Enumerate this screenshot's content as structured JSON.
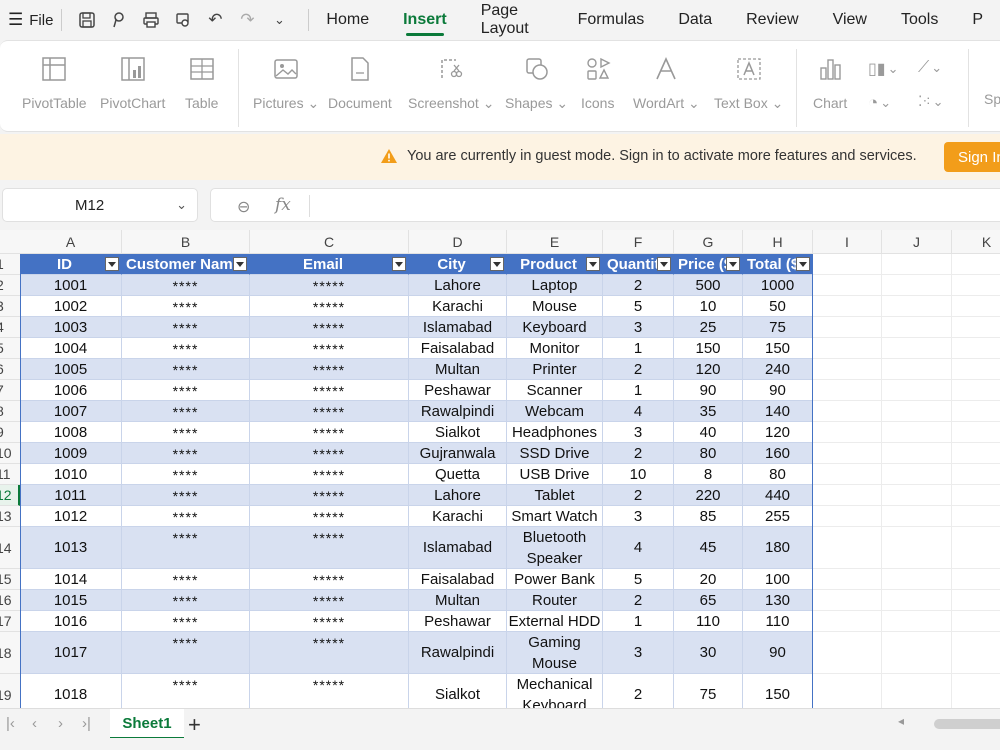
{
  "menu": {
    "file_label": "File",
    "tabs": [
      "Home",
      "Insert",
      "Page Layout",
      "Formulas",
      "Data",
      "Review",
      "View",
      "Tools",
      "P"
    ],
    "active_tab": "Insert"
  },
  "ribbon": {
    "items": [
      {
        "label": "PivotTable",
        "icon": "pivot-table-icon"
      },
      {
        "label": "PivotChart",
        "icon": "pivot-chart-icon"
      },
      {
        "label": "Table",
        "icon": "table-icon"
      },
      {
        "label": "Pictures",
        "icon": "picture-icon"
      },
      {
        "label": "Document",
        "icon": "document-icon"
      },
      {
        "label": "Screenshot",
        "icon": "screenshot-icon"
      },
      {
        "label": "Shapes",
        "icon": "shapes-icon"
      },
      {
        "label": "Icons",
        "icon": "icons-icon"
      },
      {
        "label": "WordArt",
        "icon": "wordart-icon"
      },
      {
        "label": "Text Box",
        "icon": "textbox-icon"
      },
      {
        "label": "Chart",
        "icon": "chart-icon"
      },
      {
        "label": "Sp",
        "icon": "sparkline-icon"
      }
    ]
  },
  "notice": {
    "message": "You are currently in guest mode. Sign in to activate more features and services.",
    "signin_label": "Sign In"
  },
  "formula_bar": {
    "cell_ref": "M12",
    "fx_label": "fx",
    "value": ""
  },
  "columns": [
    "A",
    "B",
    "C",
    "D",
    "E",
    "F",
    "G",
    "H",
    "I",
    "J",
    "K"
  ],
  "table": {
    "headers": [
      "ID",
      "Customer Name",
      "Email",
      "City",
      "Product",
      "Quantity",
      "Price ($)",
      "Total ($)"
    ],
    "rows": [
      [
        "1001",
        "****",
        "*****",
        "Lahore",
        "Laptop",
        "2",
        "500",
        "1000"
      ],
      [
        "1002",
        "****",
        "*****",
        "Karachi",
        "Mouse",
        "5",
        "10",
        "50"
      ],
      [
        "1003",
        "****",
        "*****",
        "Islamabad",
        "Keyboard",
        "3",
        "25",
        "75"
      ],
      [
        "1004",
        "****",
        "*****",
        "Faisalabad",
        "Monitor",
        "1",
        "150",
        "150"
      ],
      [
        "1005",
        "****",
        "*****",
        "Multan",
        "Printer",
        "2",
        "120",
        "240"
      ],
      [
        "1006",
        "****",
        "*****",
        "Peshawar",
        "Scanner",
        "1",
        "90",
        "90"
      ],
      [
        "1007",
        "****",
        "*****",
        "Rawalpindi",
        "Webcam",
        "4",
        "35",
        "140"
      ],
      [
        "1008",
        "****",
        "*****",
        "Sialkot",
        "Headphones",
        "3",
        "40",
        "120"
      ],
      [
        "1009",
        "****",
        "*****",
        "Gujranwala",
        "SSD Drive",
        "2",
        "80",
        "160"
      ],
      [
        "1010",
        "****",
        "*****",
        "Quetta",
        "USB Drive",
        "10",
        "8",
        "80"
      ],
      [
        "1011",
        "****",
        "*****",
        "Lahore",
        "Tablet",
        "2",
        "220",
        "440"
      ],
      [
        "1012",
        "****",
        "*****",
        "Karachi",
        "Smart Watch",
        "3",
        "85",
        "255"
      ],
      [
        "1013",
        "****",
        "*****",
        "Islamabad",
        "Bluetooth Speaker",
        "4",
        "45",
        "180"
      ],
      [
        "1014",
        "****",
        "*****",
        "Faisalabad",
        "Power Bank",
        "5",
        "20",
        "100"
      ],
      [
        "1015",
        "****",
        "*****",
        "Multan",
        "Router",
        "2",
        "65",
        "130"
      ],
      [
        "1016",
        "****",
        "*****",
        "Peshawar",
        "External HDD",
        "1",
        "110",
        "110"
      ],
      [
        "1017",
        "****",
        "*****",
        "Rawalpindi",
        "Gaming Mouse",
        "3",
        "30",
        "90"
      ],
      [
        "1018",
        "****",
        "*****",
        "Sialkot",
        "Mechanical Keyboard",
        "2",
        "75",
        "150"
      ]
    ]
  },
  "row_numbers": [
    "1",
    "2",
    "3",
    "4",
    "5",
    "6",
    "7",
    "8",
    "9",
    "10",
    "11",
    "12",
    "13",
    "14",
    "15",
    "16",
    "17",
    "18",
    "19"
  ],
  "selected_row": "12",
  "sheet_tab": "Sheet1",
  "colors": {
    "accent": "#0b7a3a",
    "table_header": "#4472c4",
    "band": "#d9e1f2",
    "signin": "#f29d1a"
  }
}
